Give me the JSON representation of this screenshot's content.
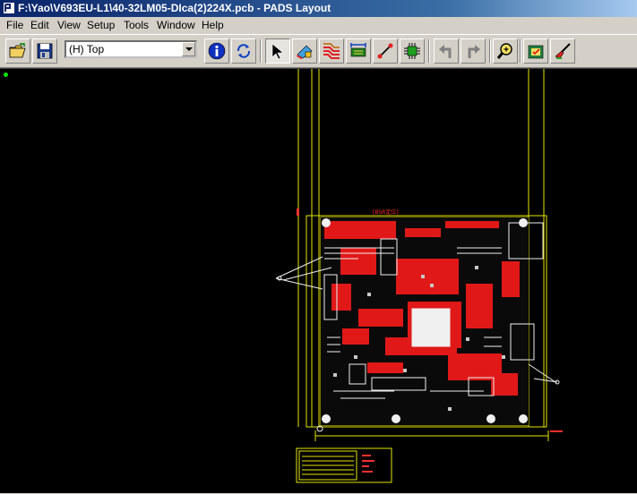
{
  "window": {
    "title": "F:\\Yao\\V693EU-L1\\40-32LM05-DIca(2)224X.pcb - PADS Layout"
  },
  "menu": [
    "File",
    "Edit",
    "View",
    "Setup",
    "Tools",
    "Window",
    "Help"
  ],
  "toolbar": {
    "layer_value": "(H) Top",
    "buttons": [
      {
        "name": "open",
        "icon": "open-folder-icon"
      },
      {
        "name": "save",
        "icon": "floppy-disk-icon"
      },
      {
        "name": "info",
        "icon": "info-icon"
      },
      {
        "name": "refresh",
        "icon": "redraw-icon"
      },
      {
        "name": "select",
        "icon": "pointer-arrow-icon",
        "pressed": true
      },
      {
        "name": "drafting",
        "icon": "drafting-toolbox-icon"
      },
      {
        "name": "design",
        "icon": "route-design-icon"
      },
      {
        "name": "dimensioning",
        "icon": "dimension-icon"
      },
      {
        "name": "ecd",
        "icon": "ecd-wire-icon"
      },
      {
        "name": "bga",
        "icon": "bga-icon"
      },
      {
        "name": "undo",
        "icon": "undo-icon"
      },
      {
        "name": "redo",
        "icon": "redo-icon"
      },
      {
        "name": "zoom",
        "icon": "zoom-icon"
      },
      {
        "name": "verify",
        "icon": "verify-design-icon"
      },
      {
        "name": "eco",
        "icon": "eco-brush-icon"
      }
    ]
  },
  "board": {
    "title_label": "[BSR定位]",
    "colors": {
      "outline": "#ffff00",
      "traces": "#ff2020",
      "silk": "#ffffff",
      "background": "#000000"
    }
  }
}
